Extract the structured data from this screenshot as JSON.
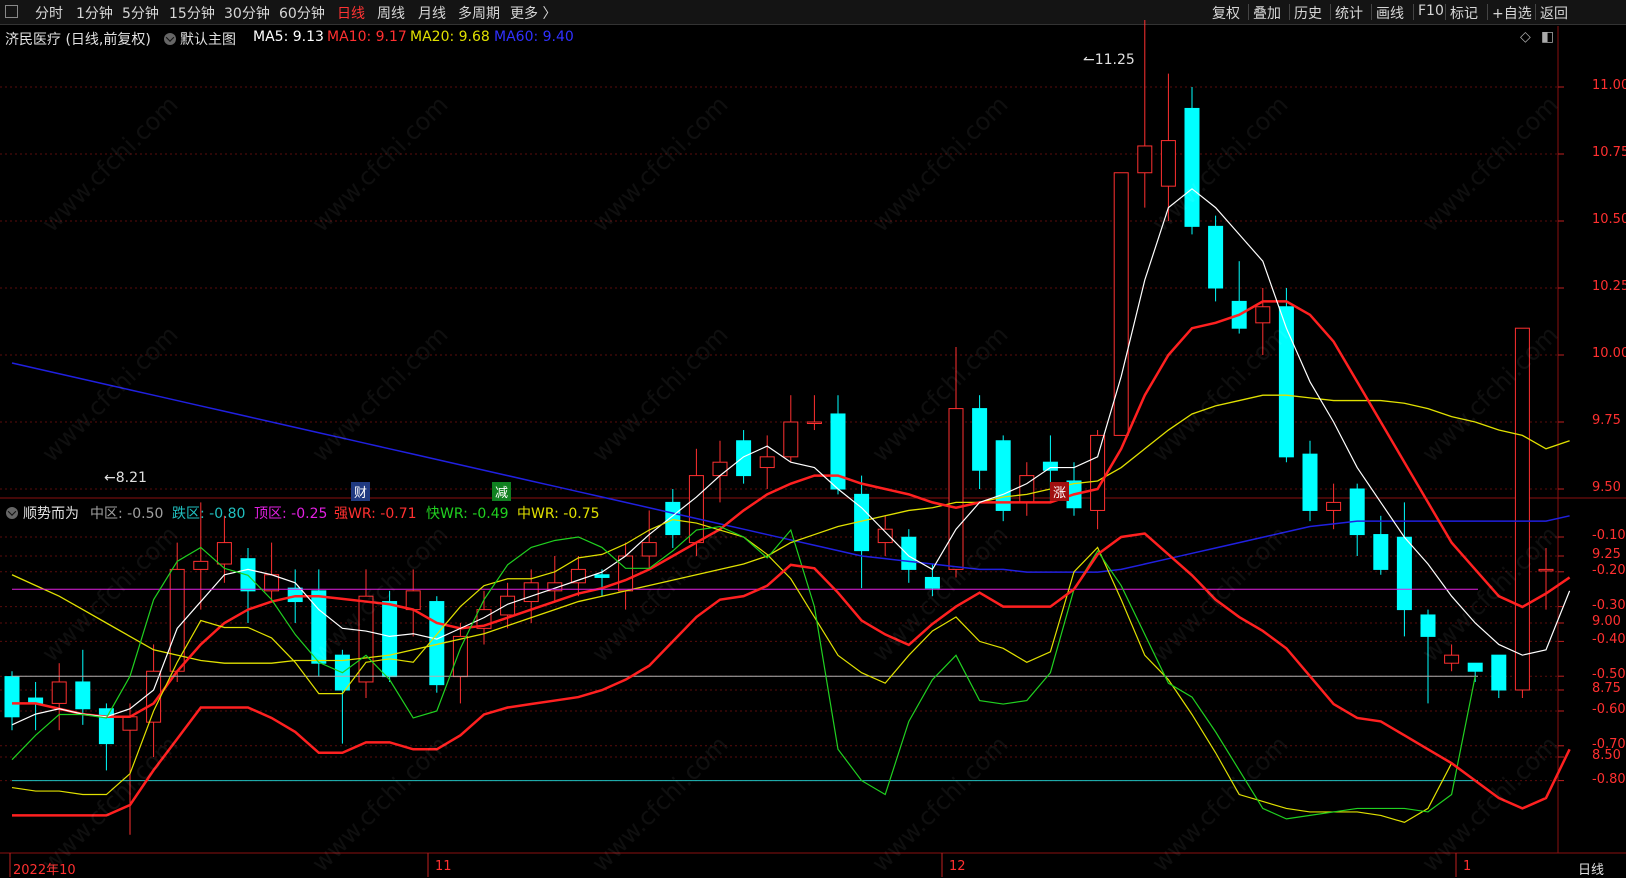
{
  "toolbar": {
    "left_items": [
      "分时",
      "1分钟",
      "5分钟",
      "15分钟",
      "30分钟",
      "60分钟",
      "日线",
      "周线",
      "月线",
      "多周期",
      "更多 〉"
    ],
    "active": "日线",
    "right_items": [
      "复权",
      "叠加",
      "历史",
      "统计",
      "画线",
      "F10",
      "标记",
      "+自选",
      "返回"
    ]
  },
  "main_info": {
    "stock": "济民医疗 (日线,前复权)",
    "template": "默认主图",
    "ma5": "MA5: 9.13",
    "ma10": "MA10: 9.17",
    "ma20": "MA20: 9.68",
    "ma60": "MA60: 9.40"
  },
  "indicator_info": {
    "name": "顺势而为",
    "mid_zone": "中区: -0.50",
    "fall_zone": "跌区: -0.80",
    "top_zone": "顶区: -0.25",
    "strong_wr": "强WR: -0.71",
    "fast_wr": "快WR: -0.49",
    "mid_wr": "中WR: -0.75"
  },
  "price_axis": [
    "11.00",
    "10.75",
    "10.50",
    "10.25",
    "10.00",
    "9.75",
    "9.50",
    "9.25",
    "9.00",
    "8.75",
    "8.50"
  ],
  "indicator_axis": [
    "-0.10",
    "-0.20",
    "-0.30",
    "-0.40",
    "-0.50",
    "-0.60",
    "-0.70",
    "-0.80"
  ],
  "annotations": {
    "high": "11.25",
    "low": "8.21"
  },
  "event_tags": [
    "财",
    "减",
    "涨"
  ],
  "date_labels": [
    "2022年10",
    "11",
    "12",
    "1"
  ],
  "period_label": "日线",
  "watermark": "www.cfchi.com",
  "colors": {
    "up": "#ff3030",
    "down": "#00ffff",
    "ma5": "#ffffff",
    "ma10": "#ff2020",
    "ma20": "#e0e000",
    "ma60": "#2020e0",
    "top_zone": "#e020e0",
    "fall_zone": "#20c0c0",
    "mid_zone": "#b0b0b0",
    "strong_wr": "#ff2020",
    "fast_wr": "#20d020",
    "mid_wr": "#e0e000"
  },
  "chart_data": {
    "type": "candlestick",
    "ohlc": [
      [
        8.8,
        8.65,
        8.82,
        8.6
      ],
      [
        8.72,
        8.7,
        8.78,
        8.6
      ],
      [
        8.7,
        8.78,
        8.85,
        8.6
      ],
      [
        8.78,
        8.68,
        8.9,
        8.62
      ],
      [
        8.68,
        8.55,
        8.7,
        8.45
      ],
      [
        8.6,
        8.65,
        8.7,
        8.21
      ],
      [
        8.63,
        8.82,
        8.92,
        8.5
      ],
      [
        8.82,
        9.2,
        9.3,
        8.78
      ],
      [
        9.2,
        9.23,
        9.45,
        9.05
      ],
      [
        9.22,
        9.3,
        9.4,
        9.15
      ],
      [
        9.24,
        9.12,
        9.28,
        9.0
      ],
      [
        9.12,
        9.18,
        9.3,
        9.08
      ],
      [
        9.13,
        9.08,
        9.2,
        9.0
      ],
      [
        9.12,
        8.85,
        9.2,
        8.8
      ],
      [
        8.88,
        8.75,
        8.9,
        8.55
      ],
      [
        8.78,
        9.1,
        9.2,
        8.72
      ],
      [
        9.08,
        8.8,
        9.12,
        8.78
      ],
      [
        9.05,
        9.12,
        9.2,
        8.95
      ],
      [
        9.08,
        8.77,
        9.1,
        8.74
      ],
      [
        8.8,
        8.95,
        9.0,
        8.7
      ],
      [
        8.98,
        9.05,
        9.12,
        8.92
      ],
      [
        9.03,
        9.1,
        9.15,
        8.98
      ],
      [
        9.08,
        9.15,
        9.2,
        9.0
      ],
      [
        9.12,
        9.15,
        9.25,
        9.08
      ],
      [
        9.15,
        9.2,
        9.25,
        9.1
      ],
      [
        9.18,
        9.17,
        9.2,
        9.1
      ],
      [
        9.12,
        9.25,
        9.3,
        9.05
      ],
      [
        9.25,
        9.3,
        9.42,
        9.2
      ],
      [
        9.45,
        9.33,
        9.5,
        9.28
      ],
      [
        9.3,
        9.55,
        9.65,
        9.25
      ],
      [
        9.55,
        9.6,
        9.68,
        9.45
      ],
      [
        9.68,
        9.55,
        9.72,
        9.52
      ],
      [
        9.58,
        9.62,
        9.7,
        9.5
      ],
      [
        9.62,
        9.75,
        9.85,
        9.6
      ],
      [
        9.75,
        9.75,
        9.85,
        9.72
      ],
      [
        9.78,
        9.5,
        9.85,
        9.48
      ],
      [
        9.48,
        9.27,
        9.55,
        9.13
      ],
      [
        9.3,
        9.35,
        9.4,
        9.25
      ],
      [
        9.32,
        9.2,
        9.35,
        9.15
      ],
      [
        9.17,
        9.13,
        9.22,
        9.1
      ],
      [
        9.2,
        9.8,
        10.03,
        9.17
      ],
      [
        9.8,
        9.57,
        9.85,
        9.5
      ],
      [
        9.68,
        9.42,
        9.7,
        9.38
      ],
      [
        9.45,
        9.55,
        9.6,
        9.4
      ],
      [
        9.6,
        9.57,
        9.7,
        9.45
      ],
      [
        9.53,
        9.43,
        9.6,
        9.4
      ],
      [
        9.42,
        9.7,
        9.72,
        9.35
      ],
      [
        9.7,
        10.68,
        10.68,
        9.7
      ],
      [
        10.68,
        10.78,
        11.25,
        10.55
      ],
      [
        10.63,
        10.8,
        11.05,
        10.5
      ],
      [
        10.92,
        10.48,
        11.0,
        10.45
      ],
      [
        10.48,
        10.25,
        10.52,
        10.2
      ],
      [
        10.2,
        10.1,
        10.35,
        10.08
      ],
      [
        10.12,
        10.18,
        10.25,
        10.0
      ],
      [
        10.18,
        9.62,
        10.25,
        9.6
      ],
      [
        9.63,
        9.42,
        9.68,
        9.38
      ],
      [
        9.42,
        9.45,
        9.52,
        9.35
      ],
      [
        9.5,
        9.33,
        9.52,
        9.25
      ],
      [
        9.33,
        9.2,
        9.4,
        9.18
      ],
      [
        9.32,
        9.05,
        9.45,
        8.95
      ],
      [
        9.03,
        8.95,
        9.05,
        8.7
      ],
      [
        8.85,
        8.88,
        8.92,
        8.82
      ],
      [
        8.85,
        8.82,
        8.85,
        8.78
      ],
      [
        8.88,
        8.75,
        8.88,
        8.72
      ],
      [
        8.75,
        10.1,
        10.1,
        8.72
      ],
      [
        9.2,
        9.2,
        9.28,
        9.05
      ]
    ],
    "ma5": [
      8.62,
      8.66,
      8.68,
      8.66,
      8.65,
      8.68,
      8.75,
      8.98,
      9.08,
      9.18,
      9.2,
      9.18,
      9.15,
      9.05,
      8.98,
      8.97,
      8.95,
      8.96,
      8.94,
      8.98,
      9.02,
      9.07,
      9.1,
      9.13,
      9.16,
      9.19,
      9.25,
      9.33,
      9.4,
      9.47,
      9.55,
      9.62,
      9.66,
      9.6,
      9.58,
      9.5,
      9.43,
      9.34,
      9.25,
      9.2,
      9.35,
      9.45,
      9.48,
      9.52,
      9.58,
      9.58,
      9.62,
      9.92,
      10.28,
      10.55,
      10.62,
      10.55,
      10.45,
      10.35,
      10.1,
      9.9,
      9.75,
      9.58,
      9.45,
      9.32,
      9.22,
      9.1,
      9.0,
      8.92,
      8.88,
      8.9,
      9.12
    ],
    "ma10": [
      8.7,
      8.7,
      8.68,
      8.66,
      8.65,
      8.65,
      8.7,
      8.82,
      8.92,
      9.0,
      9.05,
      9.08,
      9.1,
      9.1,
      9.09,
      9.08,
      9.07,
      9.05,
      9.0,
      8.98,
      8.99,
      9.02,
      9.05,
      9.08,
      9.11,
      9.13,
      9.16,
      9.2,
      9.25,
      9.3,
      9.35,
      9.42,
      9.48,
      9.52,
      9.55,
      9.55,
      9.52,
      9.5,
      9.48,
      9.45,
      9.43,
      9.45,
      9.45,
      9.45,
      9.45,
      9.48,
      9.5,
      9.65,
      9.85,
      10.0,
      10.1,
      10.12,
      10.15,
      10.2,
      10.2,
      10.15,
      10.05,
      9.9,
      9.75,
      9.6,
      9.45,
      9.3,
      9.2,
      9.1,
      9.06,
      9.11,
      9.17
    ],
    "ma20": [
      9.18,
      9.14,
      9.1,
      9.05,
      9.0,
      8.95,
      8.9,
      8.88,
      8.86,
      8.85,
      8.85,
      8.85,
      8.86,
      8.86,
      8.86,
      8.87,
      8.88,
      8.9,
      8.92,
      8.94,
      8.96,
      8.99,
      9.02,
      9.05,
      9.08,
      9.1,
      9.12,
      9.14,
      9.16,
      9.18,
      9.2,
      9.22,
      9.25,
      9.3,
      9.33,
      9.36,
      9.38,
      9.4,
      9.42,
      9.43,
      9.45,
      9.45,
      9.47,
      9.48,
      9.5,
      9.52,
      9.53,
      9.58,
      9.65,
      9.72,
      9.78,
      9.81,
      9.83,
      9.85,
      9.85,
      9.84,
      9.83,
      9.83,
      9.83,
      9.82,
      9.8,
      9.77,
      9.75,
      9.72,
      9.7,
      9.65,
      9.68
    ],
    "ma60": [
      9.97,
      9.95,
      9.93,
      9.91,
      9.89,
      9.87,
      9.85,
      9.83,
      9.81,
      9.79,
      9.77,
      9.75,
      9.73,
      9.71,
      9.69,
      9.67,
      9.65,
      9.63,
      9.61,
      9.59,
      9.57,
      9.55,
      9.53,
      9.51,
      9.49,
      9.47,
      9.45,
      9.43,
      9.41,
      9.39,
      9.37,
      9.35,
      9.33,
      9.31,
      9.29,
      9.27,
      9.25,
      9.24,
      9.23,
      9.22,
      9.21,
      9.2,
      9.2,
      9.19,
      9.19,
      9.19,
      9.19,
      9.2,
      9.22,
      9.24,
      9.26,
      9.28,
      9.3,
      9.32,
      9.34,
      9.36,
      9.37,
      9.38,
      9.38,
      9.38,
      9.38,
      9.38,
      9.38,
      9.38,
      9.38,
      9.38,
      9.4
    ],
    "indicator": {
      "levels": {
        "top": -0.25,
        "mid": -0.5,
        "fall": -0.8
      },
      "strong_wr": [
        -0.9,
        -0.9,
        -0.9,
        -0.9,
        -0.9,
        -0.87,
        -0.77,
        -0.68,
        -0.59,
        -0.59,
        -0.59,
        -0.62,
        -0.66,
        -0.72,
        -0.72,
        -0.69,
        -0.69,
        -0.71,
        -0.71,
        -0.67,
        -0.61,
        -0.59,
        -0.58,
        -0.57,
        -0.56,
        -0.54,
        -0.51,
        -0.47,
        -0.4,
        -0.33,
        -0.28,
        -0.27,
        -0.24,
        -0.18,
        -0.19,
        -0.26,
        -0.34,
        -0.38,
        -0.41,
        -0.35,
        -0.3,
        -0.26,
        -0.3,
        -0.3,
        -0.3,
        -0.25,
        -0.15,
        -0.1,
        -0.09,
        -0.15,
        -0.21,
        -0.28,
        -0.33,
        -0.37,
        -0.42,
        -0.5,
        -0.58,
        -0.62,
        -0.63,
        -0.67,
        -0.71,
        -0.75,
        -0.8,
        -0.85,
        -0.88,
        -0.85,
        -0.71
      ],
      "fast_wr": [
        -0.74,
        -0.67,
        -0.61,
        -0.61,
        -0.62,
        -0.5,
        -0.28,
        -0.17,
        -0.13,
        -0.19,
        -0.21,
        -0.28,
        -0.38,
        -0.46,
        -0.49,
        -0.44,
        -0.51,
        -0.62,
        -0.6,
        -0.42,
        -0.28,
        -0.18,
        -0.13,
        -0.11,
        -0.1,
        -0.13,
        -0.19,
        -0.19,
        -0.14,
        -0.08,
        -0.07,
        -0.1,
        -0.16,
        -0.08,
        -0.3,
        -0.71,
        -0.8,
        -0.84,
        -0.63,
        -0.51,
        -0.44,
        -0.57,
        -0.58,
        -0.57,
        -0.49,
        -0.25,
        -0.14,
        -0.24,
        -0.38,
        -0.52,
        -0.56,
        -0.66,
        -0.77,
        -0.88,
        -0.91,
        -0.9,
        -0.89,
        -0.88,
        -0.88,
        -0.88,
        -0.89,
        -0.84,
        -0.5
      ],
      "mid_wr": [
        -0.82,
        -0.83,
        -0.83,
        -0.84,
        -0.84,
        -0.78,
        -0.6,
        -0.46,
        -0.34,
        -0.36,
        -0.36,
        -0.39,
        -0.46,
        -0.55,
        -0.55,
        -0.46,
        -0.45,
        -0.46,
        -0.38,
        -0.3,
        -0.24,
        -0.22,
        -0.22,
        -0.2,
        -0.16,
        -0.15,
        -0.12,
        -0.08,
        -0.05,
        -0.06,
        -0.08,
        -0.1,
        -0.15,
        -0.22,
        -0.33,
        -0.44,
        -0.49,
        -0.52,
        -0.44,
        -0.37,
        -0.33,
        -0.4,
        -0.42,
        -0.46,
        -0.43,
        -0.2,
        -0.13,
        -0.28,
        -0.44,
        -0.51,
        -0.61,
        -0.72,
        -0.84,
        -0.86,
        -0.88,
        -0.89,
        -0.89,
        -0.89,
        -0.9,
        -0.92,
        -0.88,
        -0.75
      ]
    }
  }
}
